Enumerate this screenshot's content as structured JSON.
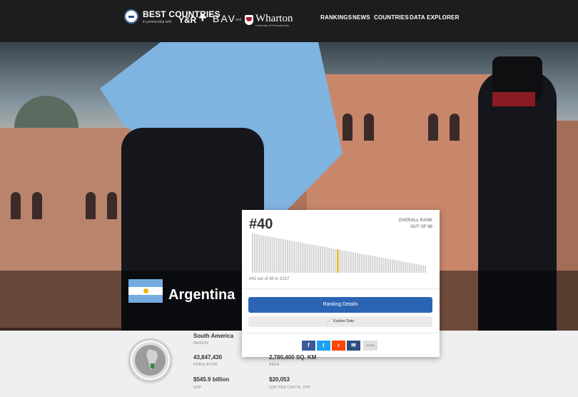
{
  "header": {
    "brand_title": "BEST COUNTRIES",
    "brand_sub": "in partnership with",
    "partner1": "Y&R",
    "partner2": "BAV",
    "partner_and": "and",
    "partner3": "Wharton",
    "partner3_sub": "University of Pennsylvania",
    "nav": [
      "RANKINGS",
      "NEWS",
      "COUNTRIES",
      "DATA EXPLORER"
    ]
  },
  "country": {
    "name": "Argentina",
    "flag_colors": [
      "#74acdf",
      "#ffffff",
      "#74acdf"
    ]
  },
  "rank_card": {
    "rank": "#40",
    "label_line1": "OVERALL RANK",
    "label_line2": "OUT OF 80",
    "caption": "#42 out of 80 in 2017",
    "ranking_button": "Ranking Details",
    "explore_button": "Explore Data",
    "share_more": "MORE"
  },
  "chart_data": {
    "type": "bar",
    "title": "",
    "total_countries": 80,
    "highlight_index": 40,
    "highlight_color": "#e0a800",
    "bar_color": "#d4d4d4",
    "ylim": [
      0,
      100
    ]
  },
  "stats": {
    "region_value": "South America",
    "region_label": "REGION",
    "population_value": "43,847,430",
    "population_label": "POPULATION",
    "area_value": "2,780,400 SQ. KM",
    "area_label": "AREA",
    "gdp_value": "$545.9 billion",
    "gdp_label": "GDP",
    "gdp_pc_value": "$20,053",
    "gdp_pc_label": "GDP PER CAPITA, PPP"
  }
}
